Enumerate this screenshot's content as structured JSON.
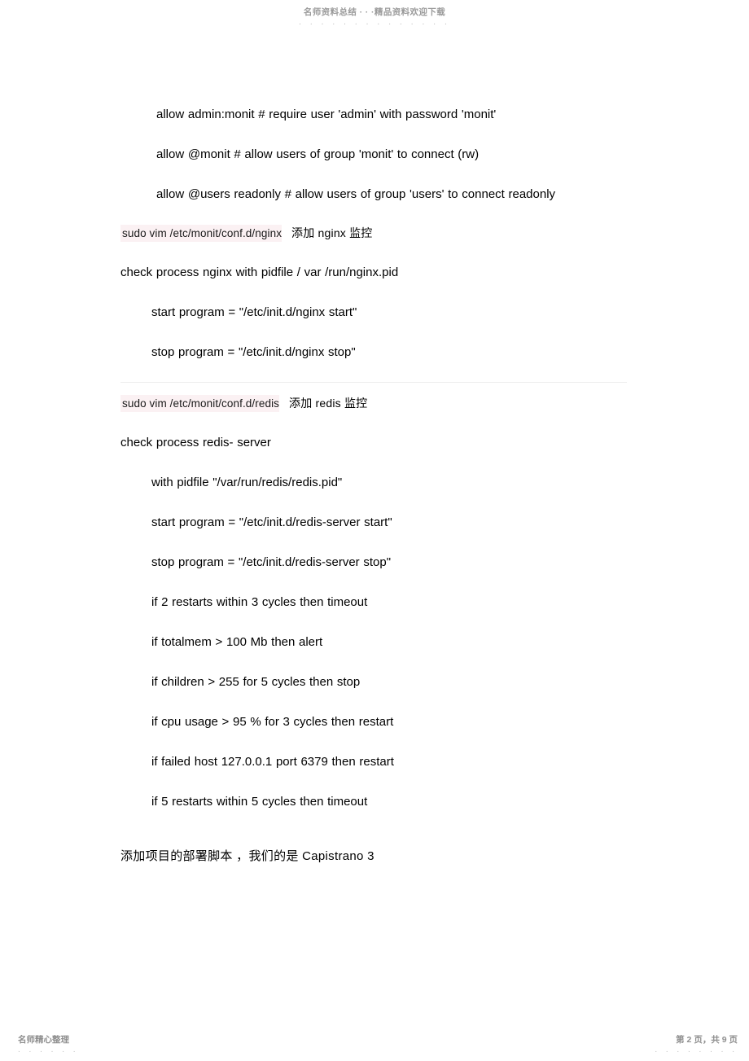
{
  "header": {
    "watermark_text": "名师资料总结 · · ·精品资料欢迎下载",
    "watermark_dots": ". . . . . . . . . . . . . ."
  },
  "body": {
    "lines": [
      {
        "id": "allow-admin-monit",
        "text": "allow  admin:monit        # require  user 'admin'  with  password 'monit'"
      },
      {
        "id": "allow-group-monit",
        "text": "allow  @monit              # allow  users  of  group  'monit'  to  connect (rw)"
      },
      {
        "id": "allow-group-users",
        "text": "allow  @users readonly   # allow  users  of  group  'users'  to  connect readonly"
      }
    ],
    "nginx_block": {
      "command": "sudo  vim  /etc/monit/conf.d/nginx",
      "note": "添加 nginx  监控",
      "lines": [
        {
          "id": "nginx-check",
          "text": "check  process   nginx  with   pidfile     / var /run/nginx.pid"
        },
        {
          "id": "nginx-start",
          "text": "start   program   =  \"/etc/init.d/nginx          start\""
        },
        {
          "id": "nginx-stop",
          "text": "stop  program   =  \"/etc/init.d/nginx          stop\""
        }
      ]
    },
    "redis_block": {
      "command": "sudo  vim  /etc/monit/conf.d/redis",
      "note": "添加 redis  监控",
      "lines": [
        {
          "id": "redis-check",
          "text": "check  process   redis-  server"
        },
        {
          "id": "redis-pidfile",
          "text": "with   pidfile      \"/var/run/redis/redis.pid\""
        },
        {
          "id": "redis-start",
          "text": "start   program   =  \"/etc/init.d/redis-server             start\""
        },
        {
          "id": "redis-stop",
          "text": "stop  program   =  \"/etc/init.d/redis-server            stop\""
        },
        {
          "id": "redis-restarts-3",
          "text": "if  2 restarts    within    3 cycles    then  timeout"
        },
        {
          "id": "redis-totalmem",
          "text": "if   totalmem    > 100  Mb then   alert"
        },
        {
          "id": "redis-children",
          "text": "if   children     > 255  for   5 cycles    then   stop"
        },
        {
          "id": "redis-cpu",
          "text": "if   cpu  usage   > 95 % for   3 cycles   then   restart"
        },
        {
          "id": "redis-host",
          "text": "if   failed    host  127.0.0.1    port   6379 then   restart"
        },
        {
          "id": "redis-restarts-5",
          "text": "if  5 restarts    within    5 cycles    then  timeout"
        }
      ]
    },
    "closing_paragraph": "添加项目的部署脚本  ，我们的是  Capistrano  3"
  },
  "footer": {
    "left_text": "名师精心整理",
    "left_dots": ". . . . . .",
    "right_text": "第 2 页，共 9 页",
    "right_dots": ". . . . . . . ."
  },
  "colors": {
    "highlight": "#fbf1f3",
    "text": "#000000",
    "watermark": "#9a9a9a",
    "rule": "#ececec"
  }
}
